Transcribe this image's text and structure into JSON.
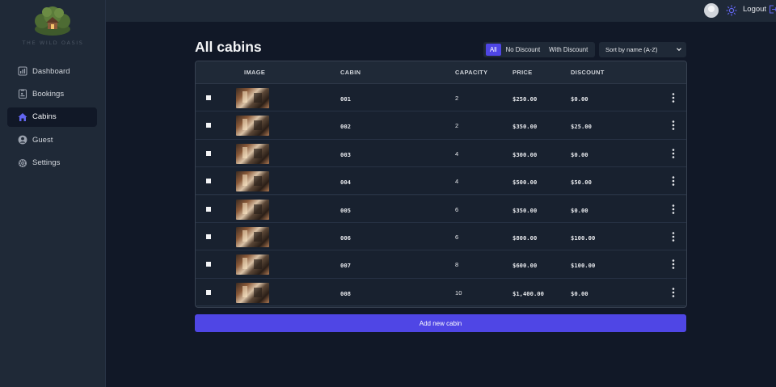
{
  "brand": {
    "name": "THE WILD OASIS"
  },
  "sidebar": {
    "items": [
      {
        "label": "Dashboard",
        "icon": "chart-bar-icon"
      },
      {
        "label": "Bookings",
        "icon": "clipboard-icon"
      },
      {
        "label": "Cabins",
        "icon": "home-icon",
        "active": true
      },
      {
        "label": "Guest",
        "icon": "user-circle-icon"
      },
      {
        "label": "Settings",
        "icon": "gear-icon"
      }
    ]
  },
  "header": {
    "logout_label": "Logout"
  },
  "page": {
    "title": "All cabins"
  },
  "filter": {
    "options": [
      "All",
      "No Discount",
      "With Discount"
    ],
    "active": "All"
  },
  "sort": {
    "selected": "Sort by name (A-Z)"
  },
  "table": {
    "headers": [
      "IMAGE",
      "CABIN",
      "CAPACITY",
      "PRICE",
      "DISCOUNT"
    ],
    "rows": [
      {
        "cabin": "001",
        "capacity": "2",
        "price": "$250.00",
        "discount": "$0.00"
      },
      {
        "cabin": "002",
        "capacity": "2",
        "price": "$350.00",
        "discount": "$25.00"
      },
      {
        "cabin": "003",
        "capacity": "4",
        "price": "$300.00",
        "discount": "$0.00"
      },
      {
        "cabin": "004",
        "capacity": "4",
        "price": "$500.00",
        "discount": "$50.00"
      },
      {
        "cabin": "005",
        "capacity": "6",
        "price": "$350.00",
        "discount": "$0.00"
      },
      {
        "cabin": "006",
        "capacity": "6",
        "price": "$800.00",
        "discount": "$100.00"
      },
      {
        "cabin": "007",
        "capacity": "8",
        "price": "$600.00",
        "discount": "$100.00"
      },
      {
        "cabin": "008",
        "capacity": "10",
        "price": "$1,400.00",
        "discount": "$0.00"
      }
    ]
  },
  "actions": {
    "add_label": "Add new cabin"
  },
  "colors": {
    "accent": "#4f46e5",
    "background": "#111827",
    "panel": "#1f2937"
  }
}
